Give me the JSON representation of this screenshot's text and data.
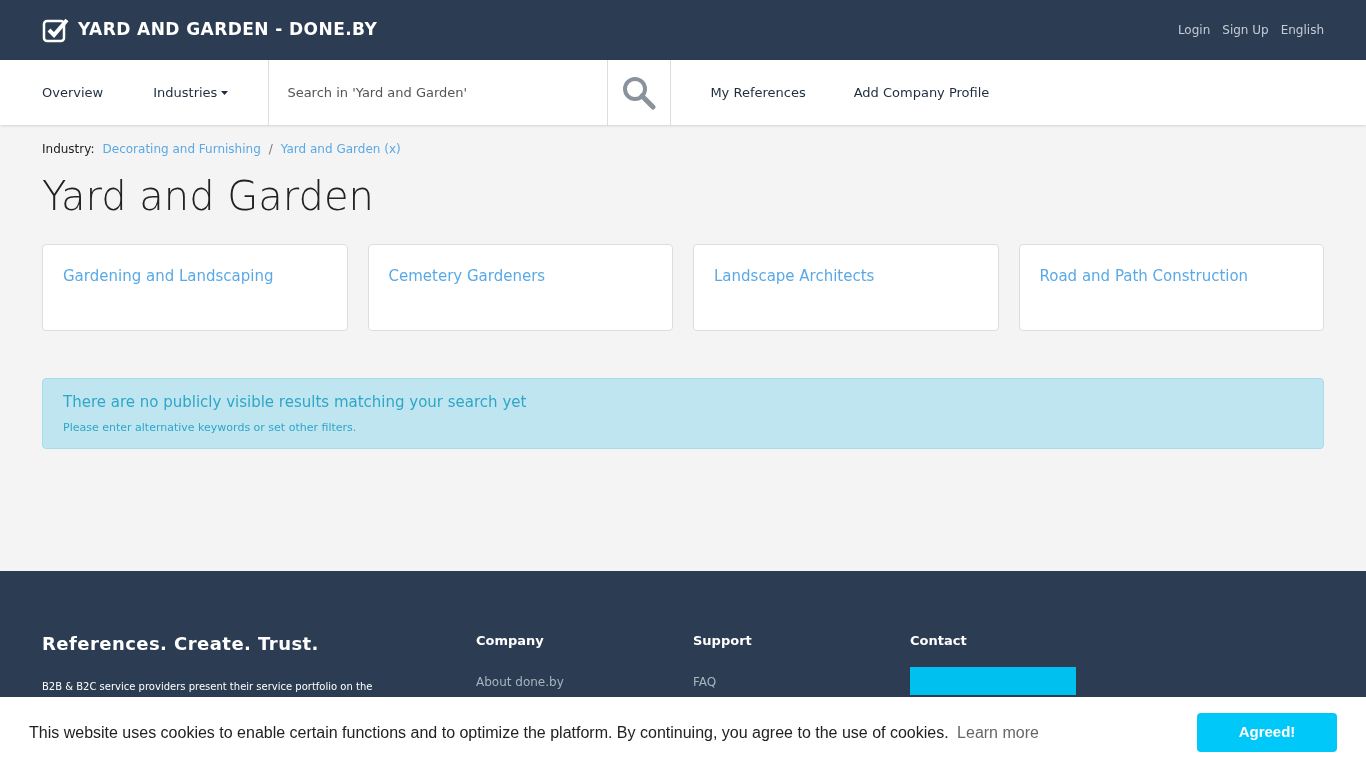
{
  "header": {
    "title": "YARD AND GARDEN - DONE.BY",
    "links": [
      "Login",
      "Sign Up",
      "English"
    ]
  },
  "nav": {
    "items": [
      {
        "label": "Overview",
        "kind": "link"
      },
      {
        "label": "Industries",
        "kind": "dropdown"
      }
    ],
    "search": {
      "placeholder": "Search in 'Yard and Garden'"
    },
    "actions": [
      "My References",
      "Add Company Profile"
    ]
  },
  "breadcrumb": {
    "label": "Industry:",
    "separator": "/",
    "items": [
      "Decorating and Furnishing",
      "Yard and Garden (x)"
    ]
  },
  "heading": "Yard and Garden",
  "categories": [
    "Gardening and Landscaping",
    "Cemetery Gardeners",
    "Landscape Architects",
    "Road and Path Construction"
  ],
  "alert": {
    "title": "There are no publicly visible results matching your search yet",
    "text": "Please enter alternative keywords or set other filters."
  },
  "footer": {
    "slogan": "References. Create. Trust.",
    "text": "B2B & B2C service providers present their service portfolio on the",
    "columns": [
      {
        "title": "Company",
        "links": [
          "About done.by"
        ]
      },
      {
        "title": "Support",
        "links": [
          "FAQ"
        ]
      },
      {
        "title": "Contact",
        "kind": "logo"
      }
    ]
  },
  "cookie": {
    "text": "This website uses cookies to enable certain functions and to optimize the platform. By continuing, you agree to the use of cookies.",
    "link": "Learn more",
    "button": "Agreed!"
  }
}
